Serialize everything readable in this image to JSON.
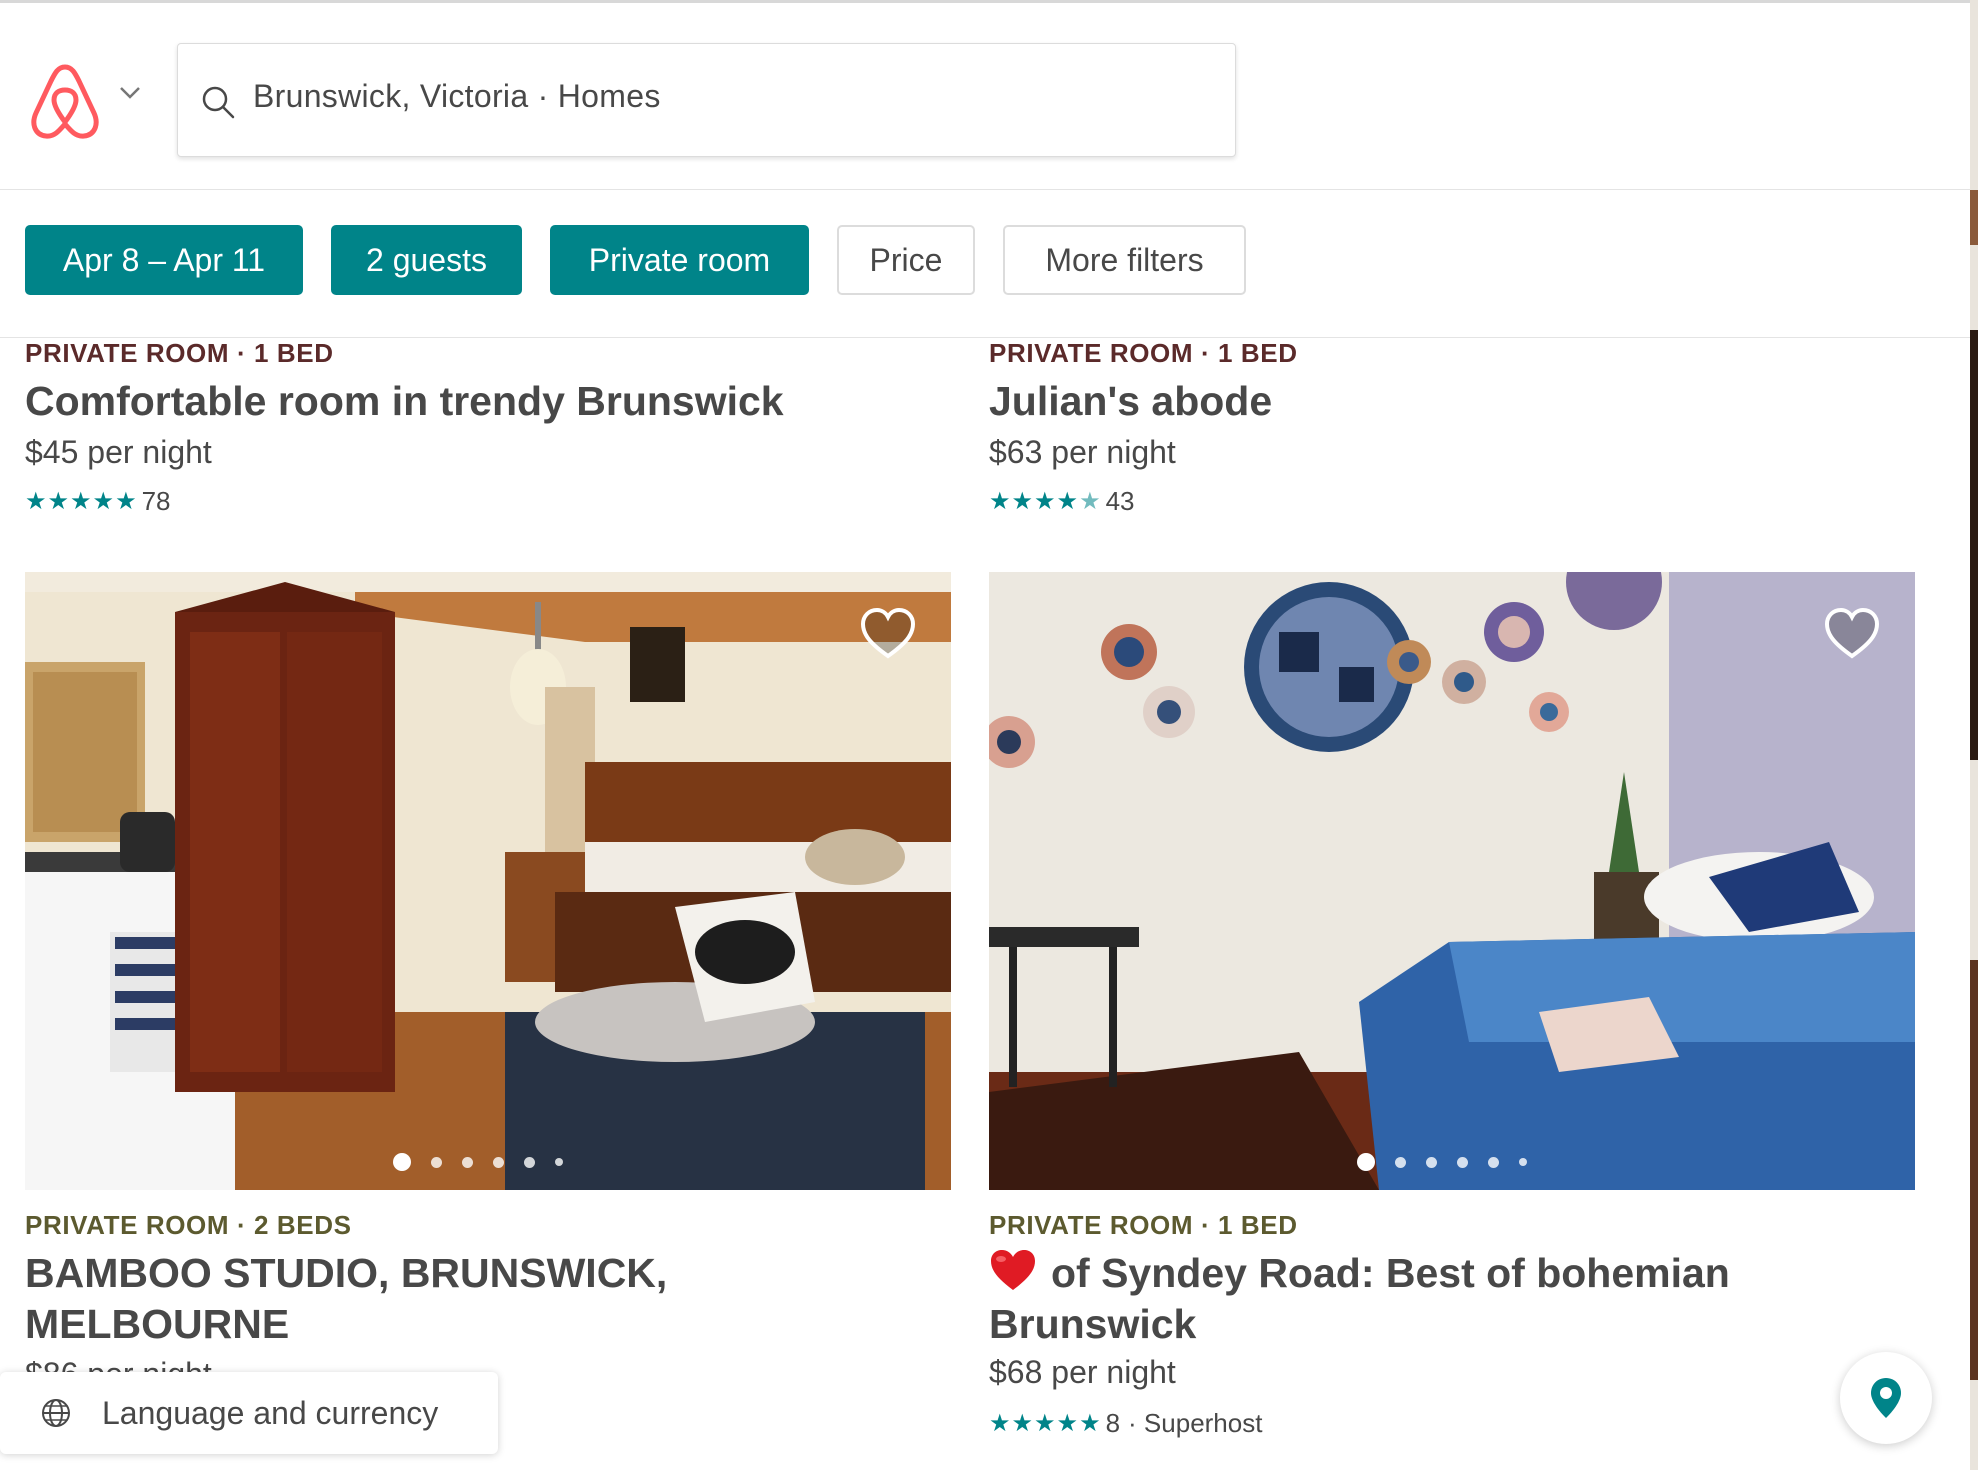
{
  "header": {
    "search_text": "Brunswick, Victoria · Homes"
  },
  "filters": [
    {
      "label": "Apr 8 – Apr 11",
      "active": true
    },
    {
      "label": "2 guests",
      "active": true
    },
    {
      "label": "Private room",
      "active": true
    },
    {
      "label": "Price",
      "active": false
    },
    {
      "label": "More filters",
      "active": false
    }
  ],
  "listings": [
    {
      "kicker": "PRIVATE ROOM · 1 BED",
      "kicker_color": "#5b2a2a",
      "title": "Comfortable room in trendy Brunswick",
      "price": "$45",
      "price_unit": "per night",
      "rating_stars": 5,
      "reviews": "78"
    },
    {
      "kicker": "PRIVATE ROOM · 1 BED",
      "kicker_color": "#5b2a2a",
      "title": "Julian's abode",
      "price": "$63",
      "price_unit": "per night",
      "rating_stars": 4.5,
      "reviews": "43"
    },
    {
      "kicker": "PRIVATE ROOM · 2 BEDS",
      "kicker_color": "#5c5a2f",
      "title": "BAMBOO STUDIO, BRUNSWICK, MELBOURNE",
      "price": "$86",
      "price_unit": "per night",
      "photo_dots": 6,
      "active_dot": 1
    },
    {
      "kicker": "PRIVATE ROOM · 1 BED",
      "kicker_color": "#5c5a2f",
      "title_emoji": "heart-emoji",
      "title": "of Syndey Road: Best of bohemian Brunswick",
      "price": "$68",
      "price_unit": "per night",
      "rating_stars": 5,
      "reviews": "8",
      "badge": "· Superhost",
      "photo_dots": 6,
      "active_dot": 1
    }
  ],
  "footer": {
    "language_label": "Language and currency"
  },
  "colors": {
    "accent": "#008489",
    "brand": "#ff5a5f",
    "text": "#484848"
  }
}
